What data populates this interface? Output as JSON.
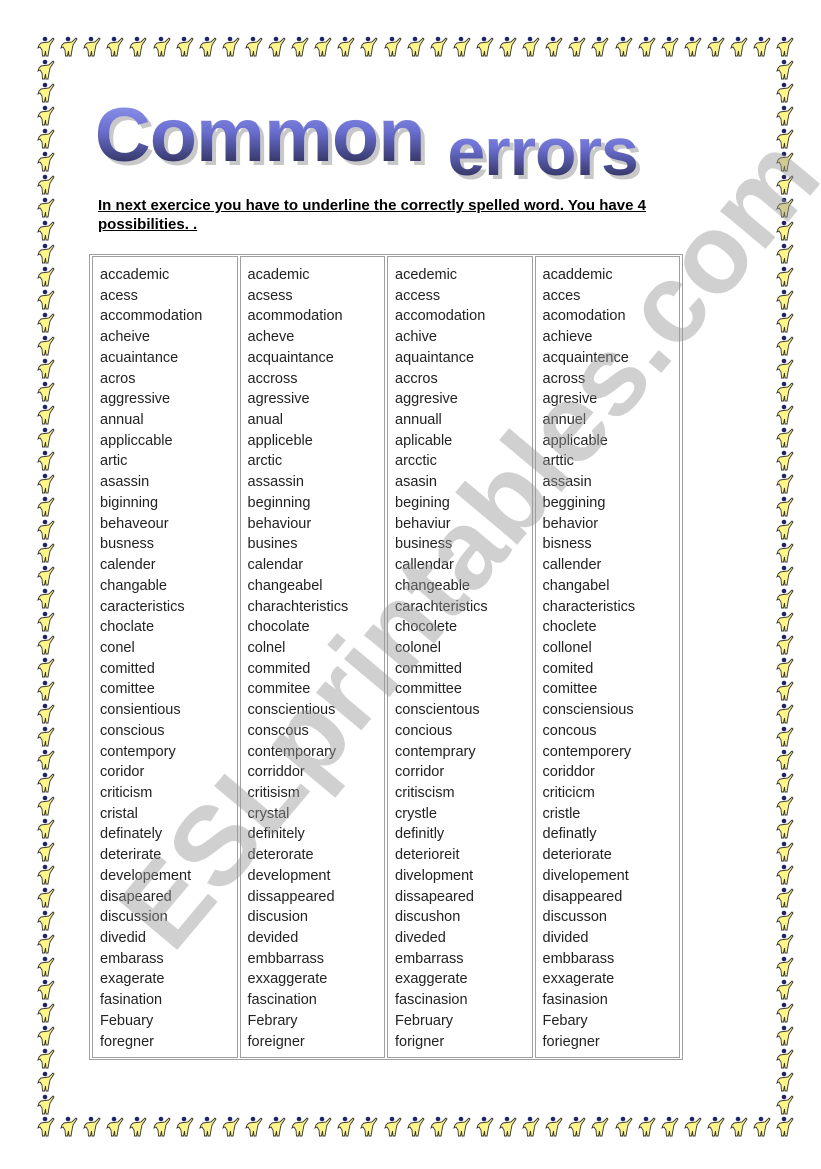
{
  "title": {
    "word1": "Common",
    "word2": "errors",
    "gradient_top": "#9a9ff5",
    "gradient_bottom": "#1a1a30"
  },
  "instructions": "In next exercice you have to underline the correctly spelled word. You have 4 possibilities.  .",
  "watermark": "ESLprintables.com",
  "border_icon": "waving-person-icon",
  "columns": [
    [
      "accademic",
      "acess",
      "accommodation",
      "acheive",
      "acuaintance",
      "acros",
      "aggressive",
      "annual",
      "appliccable",
      "artic",
      "asassin",
      "biginning",
      "behaveour",
      "busness",
      "calender",
      "changable",
      "caracteristics",
      "choclate",
      "conel",
      "comitted",
      "comittee",
      "consientious",
      "conscious",
      "contempory",
      "coridor",
      "criticism",
      "cristal",
      "definately",
      "deterirate",
      "developement",
      "disapeared",
      "discussion",
      "divedid",
      "embarass",
      "exagerate",
      "fasination",
      "Febuary",
      "foregner"
    ],
    [
      "academic",
      "acsess",
      "acommodation",
      "acheve",
      "acquaintance",
      "accross",
      "agressive",
      "anual",
      "appliceble",
      "arctic",
      "assassin",
      "beginning",
      "behaviour",
      "busines",
      "calendar",
      "changeabel",
      "charachteristics",
      "chocolate",
      "colnel",
      "commited",
      "commitee",
      "conscientious",
      "conscous",
      "contemporary",
      "corriddor",
      "critisism",
      "crystal",
      "definitely",
      "deterorate",
      "development",
      "dissappeared",
      "discusion",
      "devided",
      "embbarrass",
      "exxaggerate",
      "fascination",
      "Febrary",
      "foreigner"
    ],
    [
      "acedemic",
      "access",
      "accomodation",
      "achive",
      "aquaintance",
      "accros",
      "aggresive",
      "annuall",
      "aplicable",
      "arcctic",
      "asasin",
      "begining",
      "behaviur",
      "business",
      "callendar",
      "changeable",
      "carachteristics",
      "chocolete",
      "colonel",
      "committed",
      "committee",
      "conscientous",
      "concious",
      "contemprary",
      "corridor",
      "critiscism",
      "crystle",
      "definitly",
      "deterioreit",
      "divelopment",
      "dissapeared",
      "discushon",
      "diveded",
      "embarrass",
      "exaggerate",
      "fascinasion",
      "February",
      "forigner"
    ],
    [
      "acaddemic",
      "acces",
      "acomodation",
      "achieve",
      "acquaintence",
      "across",
      "agresive",
      "annuel",
      "applicable",
      "arttic",
      "assasin",
      "beggining",
      "behavior",
      "bisness",
      "callender",
      "changabel",
      "characteristics",
      "choclete",
      "collonel",
      "comited",
      "comittee",
      "consciensious",
      "concous",
      "contemporery",
      "coriddor",
      "criticicm",
      "cristle",
      "definatly",
      "deteriorate",
      "divelopement",
      "disappeared",
      "discusson",
      "divided",
      "embbarass",
      "exxagerate",
      "fasinasion",
      "Febary",
      "foriegner"
    ]
  ]
}
